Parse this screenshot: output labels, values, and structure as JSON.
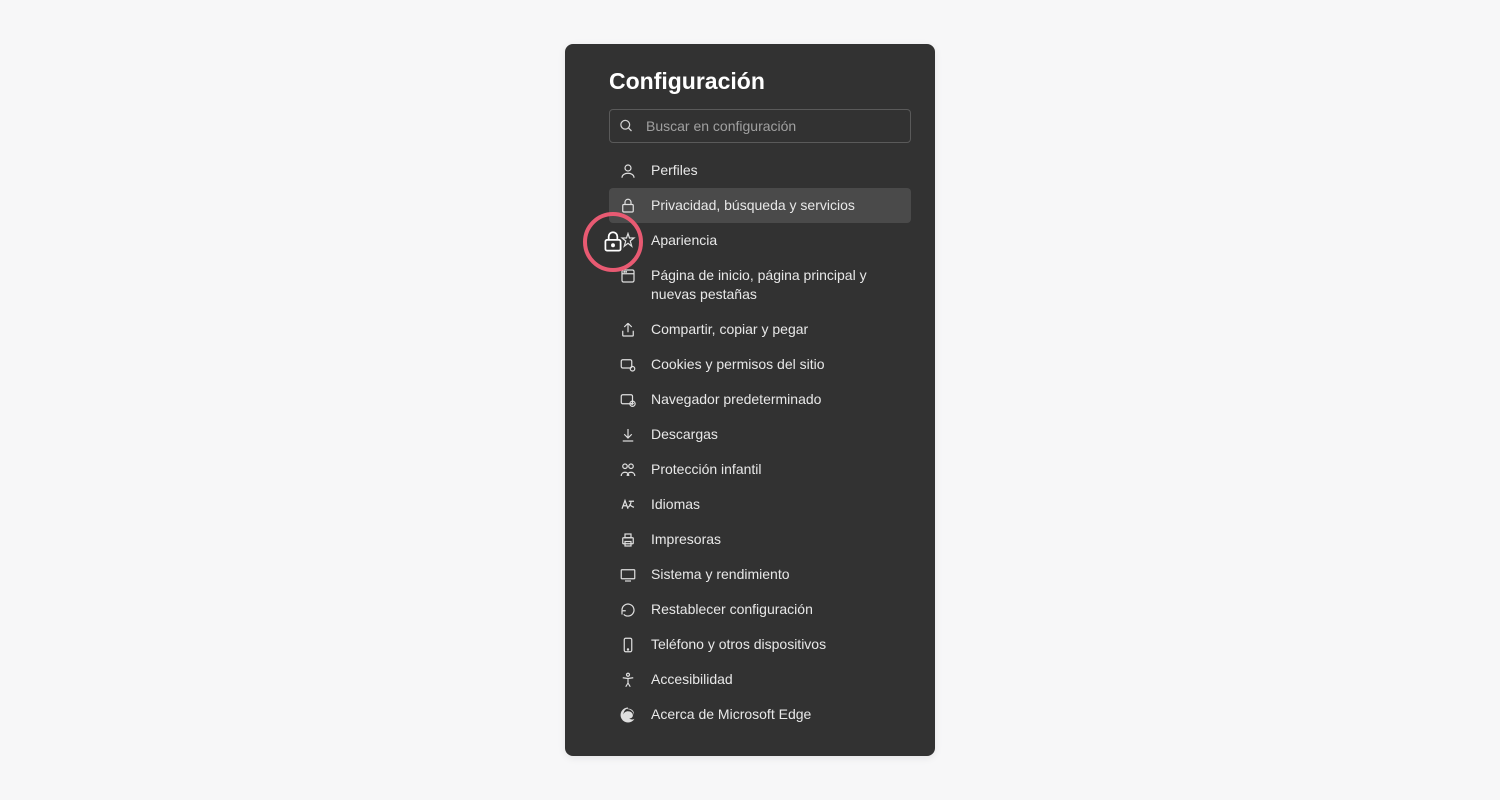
{
  "panel": {
    "title": "Configuración"
  },
  "search": {
    "placeholder": "Buscar en configuración"
  },
  "menu": {
    "items": [
      {
        "label": "Perfiles",
        "icon": "profile-icon",
        "selected": false
      },
      {
        "label": "Privacidad, búsqueda y servicios",
        "icon": "lock-icon",
        "selected": true
      },
      {
        "label": "Apariencia",
        "icon": "appearance-icon",
        "selected": false
      },
      {
        "label": "Página de inicio, página principal y nuevas pestañas",
        "icon": "home-page-icon",
        "selected": false
      },
      {
        "label": "Compartir, copiar y pegar",
        "icon": "share-icon",
        "selected": false
      },
      {
        "label": "Cookies y permisos del sitio",
        "icon": "cookies-icon",
        "selected": false
      },
      {
        "label": "Navegador predeterminado",
        "icon": "default-browser-icon",
        "selected": false
      },
      {
        "label": "Descargas",
        "icon": "download-icon",
        "selected": false
      },
      {
        "label": "Protección infantil",
        "icon": "family-icon",
        "selected": false
      },
      {
        "label": "Idiomas",
        "icon": "languages-icon",
        "selected": false
      },
      {
        "label": "Impresoras",
        "icon": "printer-icon",
        "selected": false
      },
      {
        "label": "Sistema y rendimiento",
        "icon": "system-icon",
        "selected": false
      },
      {
        "label": "Restablecer configuración",
        "icon": "reset-icon",
        "selected": false
      },
      {
        "label": "Teléfono y otros dispositivos",
        "icon": "phone-icon",
        "selected": false
      },
      {
        "label": "Accesibilidad",
        "icon": "accessibility-icon",
        "selected": false
      },
      {
        "label": "Acerca de Microsoft Edge",
        "icon": "edge-icon",
        "selected": false
      }
    ]
  },
  "highlight": {
    "icon": "lock-icon",
    "ring_color": "#e85a72"
  }
}
